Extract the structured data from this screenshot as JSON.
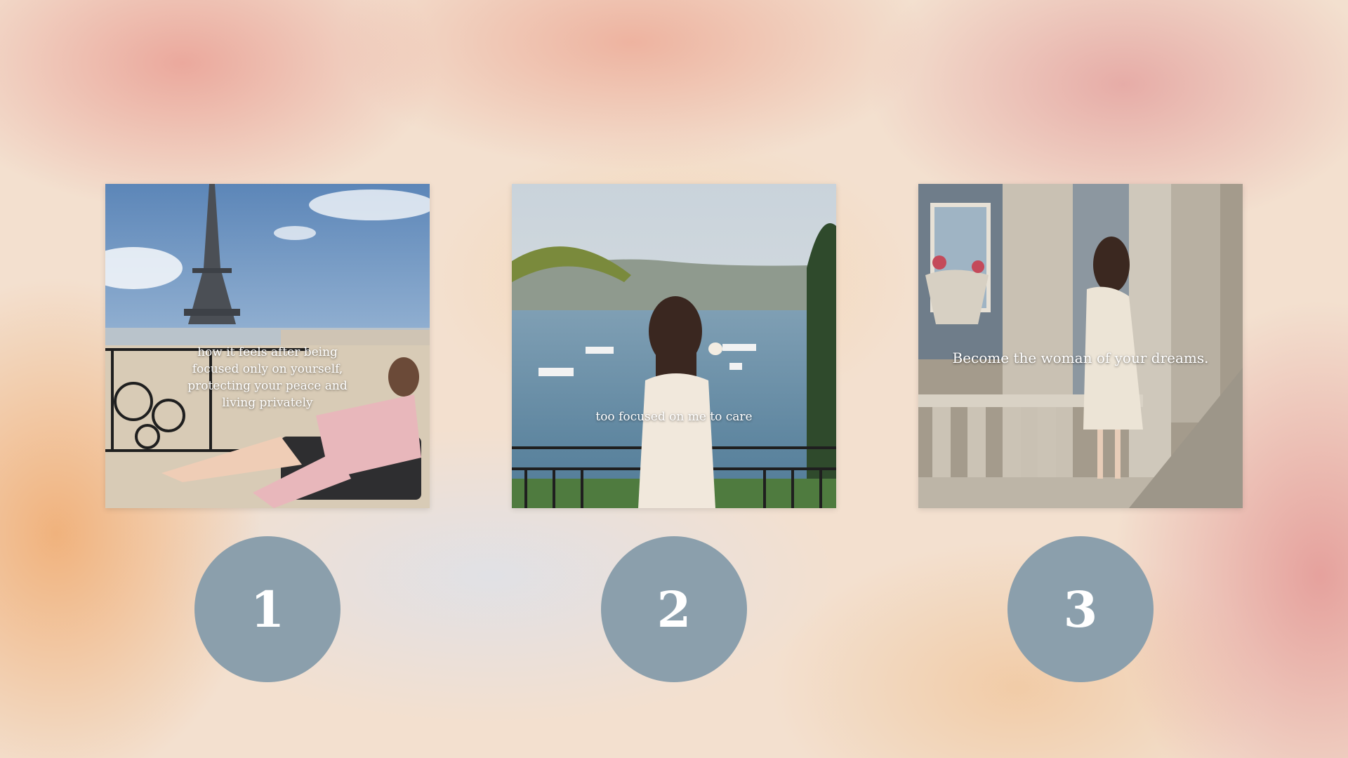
{
  "slides": [
    {
      "caption": "how it feels after being focused only on yourself, protecting your peace and living privately",
      "number": "1"
    },
    {
      "caption": "too focused on me to care",
      "number": "2"
    },
    {
      "caption": "Become the woman of your dreams.",
      "number": "3"
    }
  ],
  "colors": {
    "badge": "#8b9fac",
    "caption_text": "#ffffff"
  }
}
